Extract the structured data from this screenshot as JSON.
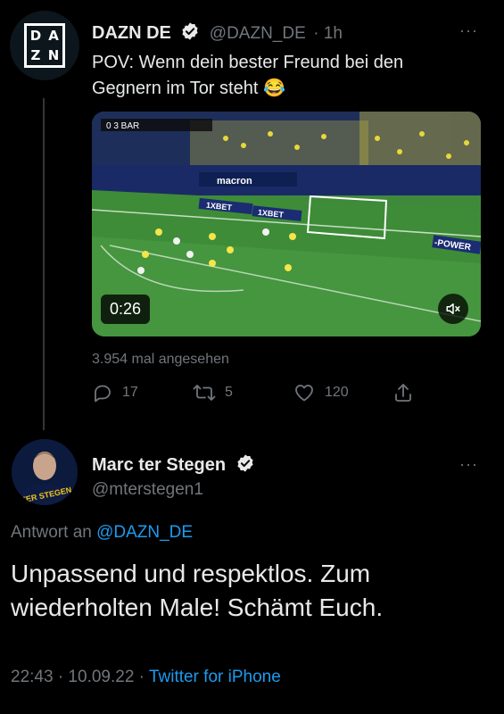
{
  "tweet1": {
    "avatar_letters": [
      "D",
      "A",
      "Z",
      "N"
    ],
    "name": "DAZN DE",
    "handle": "@DAZN_DE",
    "time": "· 1h",
    "more": "···",
    "text": "POV: Wenn dein bester Freund bei den Gegnern im Tor steht 😂",
    "video": {
      "duration": "0:26",
      "scoreboard": "0 3 BAR",
      "ads": [
        "macron",
        "1XBET",
        "1XBET",
        "-POWER"
      ]
    },
    "views": "3.954 mal angesehen",
    "actions": {
      "replies": "17",
      "retweets": "5",
      "likes": "120"
    }
  },
  "tweet2": {
    "name": "Marc ter Stegen",
    "handle": "@mterstegen1",
    "more": "···",
    "jersey": "TER STEGEN",
    "reply_label": "Antwort an",
    "reply_handle": "@DAZN_DE",
    "text": "Unpassend und respektlos. Zum wiederholten Male! Schämt Euch.",
    "timestamp": "22:43 · 10.09.22 ·",
    "source": "Twitter for iPhone"
  },
  "colors": {
    "background": "#000000",
    "accent": "#1d9bf0",
    "muted": "#71767b",
    "text": "#e7e9ea"
  }
}
